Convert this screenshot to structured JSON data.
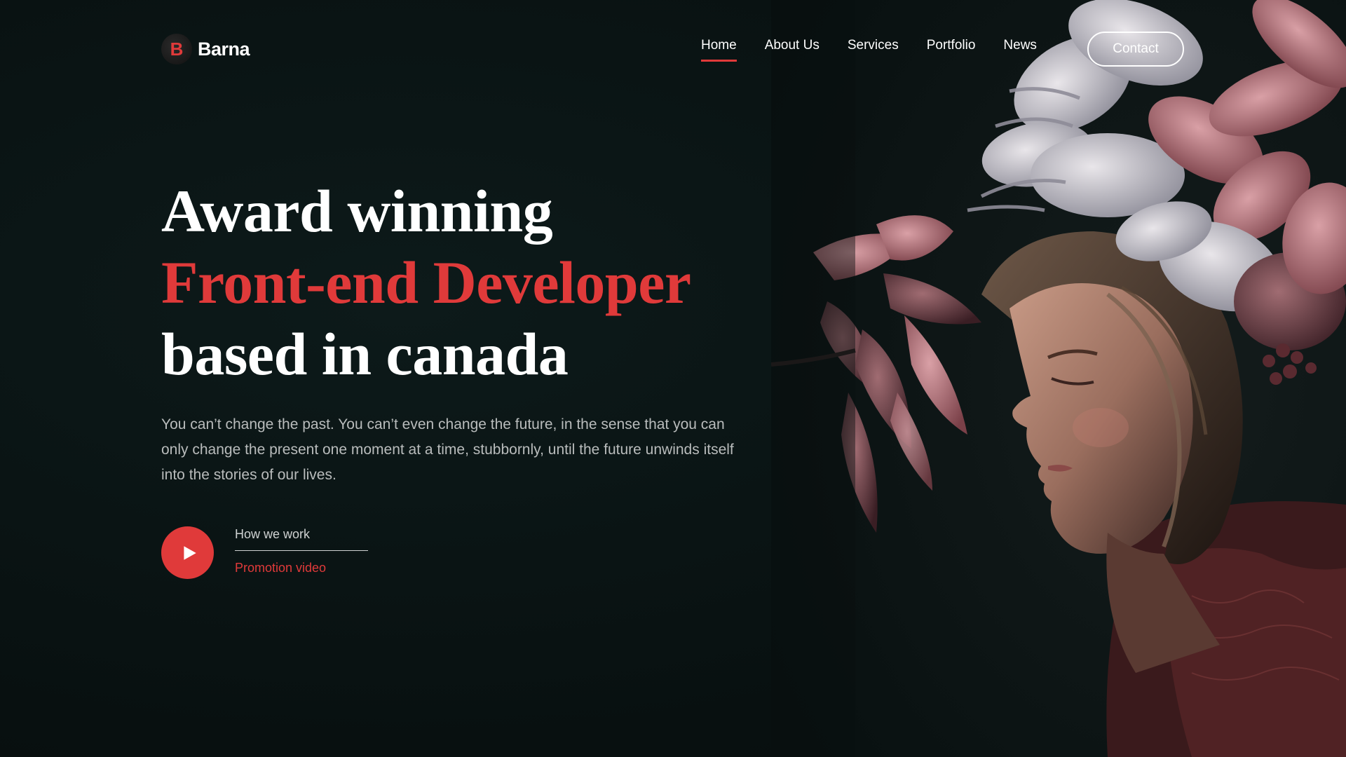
{
  "brand": {
    "logo_letter": "B",
    "name": "Barna"
  },
  "nav": {
    "items": [
      {
        "label": "Home",
        "active": true
      },
      {
        "label": "About Us",
        "active": false
      },
      {
        "label": "Services",
        "active": false
      },
      {
        "label": "Portfolio",
        "active": false
      },
      {
        "label": "News",
        "active": false
      }
    ],
    "contact_label": "Contact"
  },
  "hero": {
    "title_line1": "Award winning",
    "title_line2": "Front-end Developer",
    "title_line3": "based in canada",
    "description": "You can’t change the past. You can’t even change the future, in the sense that you can only change the present one moment at a time, stubbornly, until the future unwinds itself into the stories of our lives.",
    "video_caption": "How we work",
    "video_link": "Promotion video"
  },
  "colors": {
    "accent": "#e03a3a",
    "background": "#0a1414",
    "text": "#ffffff",
    "muted_text": "#b9bcbc"
  },
  "icons": {
    "play": "play-icon"
  }
}
